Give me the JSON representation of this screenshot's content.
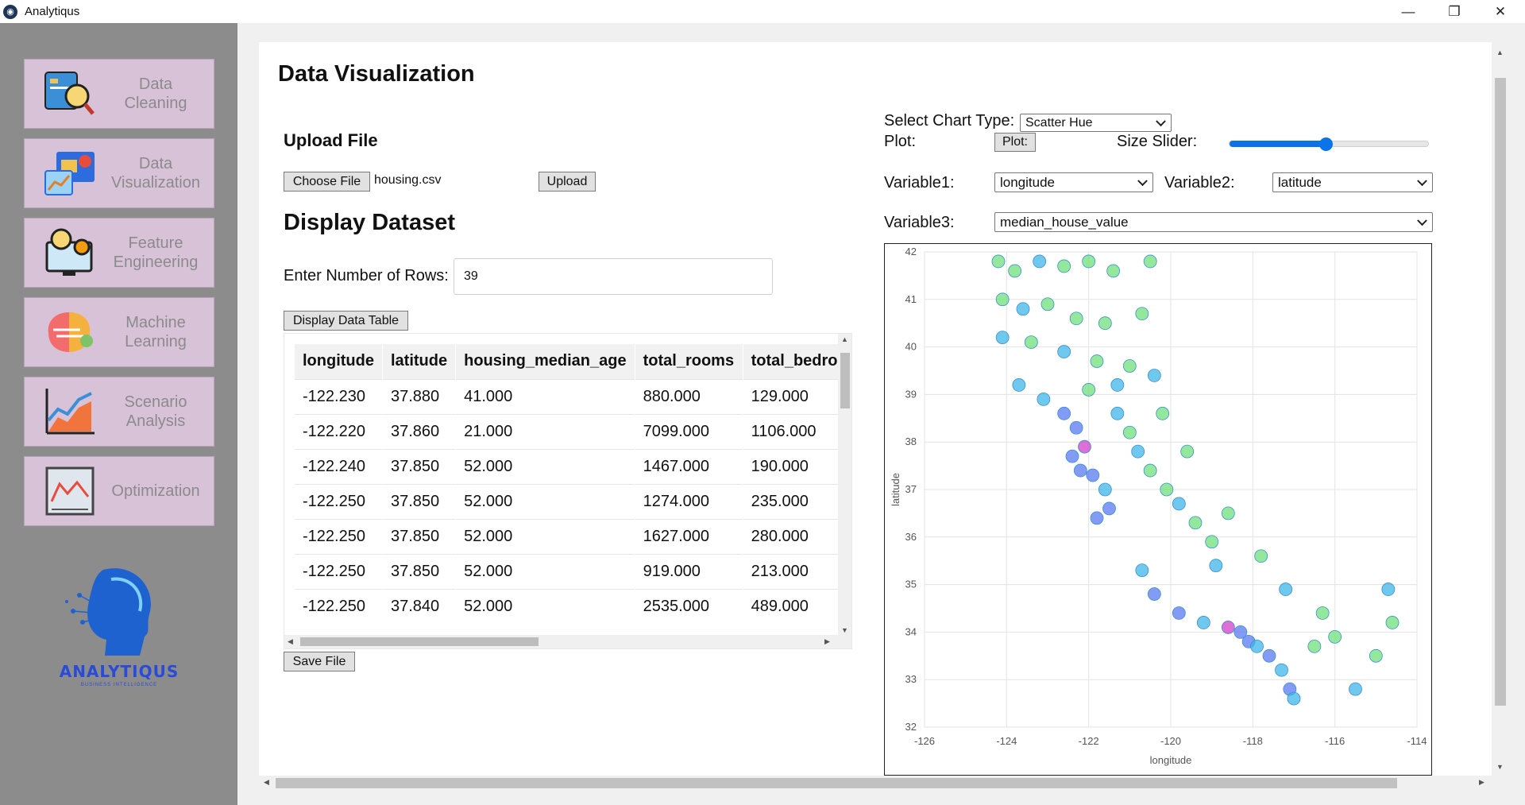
{
  "window": {
    "title": "Analytiqus",
    "controls": [
      "—",
      "❐",
      "✕"
    ]
  },
  "sidebar": {
    "items": [
      {
        "label": "Data\nCleaning",
        "icon": "data-cleaning-icon"
      },
      {
        "label": "Data\nVisualization",
        "icon": "data-visualization-icon"
      },
      {
        "label": "Feature\nEngineering",
        "icon": "feature-engineering-icon"
      },
      {
        "label": "Machine\nLearning",
        "icon": "machine-learning-icon"
      },
      {
        "label": "Scenario\nAnalysis",
        "icon": "scenario-analysis-icon"
      },
      {
        "label": "Optimization",
        "icon": "optimization-icon"
      }
    ],
    "brand": {
      "name": "ANALYTIQUS",
      "tagline": "BUSINESS INTELLIGENCE"
    }
  },
  "main": {
    "title": "Data Visualization",
    "upload": {
      "heading": "Upload File",
      "choose_label": "Choose File",
      "file_name": "housing.csv",
      "upload_label": "Upload"
    },
    "display": {
      "heading": "Display Dataset",
      "rows_label": "Enter Number of Rows:",
      "rows_value": "39",
      "display_button": "Display Data Table",
      "save_button": "Save File"
    },
    "table": {
      "columns": [
        "longitude",
        "latitude",
        "housing_median_age",
        "total_rooms",
        "total_bedro"
      ],
      "rows": [
        [
          "-122.230",
          "37.880",
          "41.000",
          "880.000",
          "129.000"
        ],
        [
          "-122.220",
          "37.860",
          "21.000",
          "7099.000",
          "1106.000"
        ],
        [
          "-122.240",
          "37.850",
          "52.000",
          "1467.000",
          "190.000"
        ],
        [
          "-122.250",
          "37.850",
          "52.000",
          "1274.000",
          "235.000"
        ],
        [
          "-122.250",
          "37.850",
          "52.000",
          "1627.000",
          "280.000"
        ],
        [
          "-122.250",
          "37.850",
          "52.000",
          "919.000",
          "213.000"
        ],
        [
          "-122.250",
          "37.840",
          "52.000",
          "2535.000",
          "489.000"
        ]
      ]
    },
    "controls": {
      "chart_type_label": "Select Chart Type:",
      "chart_type_value": "Scatter Hue",
      "plot_label": "Plot:",
      "plot_button": "Plot:",
      "size_slider_label": "Size Slider:",
      "size_slider_value": 0.48,
      "variable1_label": "Variable1:",
      "variable1_value": "longitude",
      "variable2_label": "Variable2:",
      "variable2_value": "latitude",
      "variable3_label": "Variable3:",
      "variable3_value": "median_house_value"
    }
  },
  "chart_data": {
    "type": "scatter",
    "title": "",
    "xlabel": "longitude",
    "ylabel": "latitude",
    "xlim": [
      -126,
      -114
    ],
    "ylim": [
      32,
      42
    ],
    "xticks": [
      -126,
      -124,
      -122,
      -120,
      -118,
      -116,
      -114
    ],
    "yticks": [
      32,
      33,
      34,
      35,
      36,
      37,
      38,
      39,
      40,
      41,
      42
    ],
    "grid": true,
    "hue": "median_house_value",
    "colors": {
      "low": "#6fe07a",
      "mid": "#3fb6e8",
      "high": "#5a7af0",
      "top": "#d23fc8"
    },
    "series": [
      {
        "values": [
          [
            -124.2,
            41.8,
            "low"
          ],
          [
            -123.8,
            41.6,
            "low"
          ],
          [
            -123.2,
            41.8,
            "mid"
          ],
          [
            -122.6,
            41.7,
            "low"
          ],
          [
            -122.0,
            41.8,
            "low"
          ],
          [
            -121.4,
            41.6,
            "low"
          ],
          [
            -120.5,
            41.8,
            "low"
          ],
          [
            -124.1,
            41.0,
            "low"
          ],
          [
            -123.6,
            40.8,
            "mid"
          ],
          [
            -123.0,
            40.9,
            "low"
          ],
          [
            -122.3,
            40.6,
            "low"
          ],
          [
            -121.6,
            40.5,
            "low"
          ],
          [
            -120.7,
            40.7,
            "low"
          ],
          [
            -124.1,
            40.2,
            "mid"
          ],
          [
            -123.4,
            40.1,
            "low"
          ],
          [
            -122.6,
            39.9,
            "mid"
          ],
          [
            -121.8,
            39.7,
            "low"
          ],
          [
            -121.0,
            39.6,
            "low"
          ],
          [
            -120.4,
            39.4,
            "mid"
          ],
          [
            -123.7,
            39.2,
            "mid"
          ],
          [
            -123.1,
            38.9,
            "mid"
          ],
          [
            -122.6,
            38.6,
            "high"
          ],
          [
            -122.3,
            38.3,
            "high"
          ],
          [
            -122.1,
            37.9,
            "top"
          ],
          [
            -122.4,
            37.7,
            "high"
          ],
          [
            -122.2,
            37.4,
            "high"
          ],
          [
            -121.9,
            37.3,
            "high"
          ],
          [
            -121.6,
            37.0,
            "mid"
          ],
          [
            -121.3,
            38.6,
            "mid"
          ],
          [
            -121.0,
            38.2,
            "low"
          ],
          [
            -120.8,
            37.8,
            "mid"
          ],
          [
            -120.5,
            37.4,
            "low"
          ],
          [
            -120.1,
            37.0,
            "low"
          ],
          [
            -119.8,
            36.7,
            "mid"
          ],
          [
            -119.4,
            36.3,
            "low"
          ],
          [
            -119.0,
            35.9,
            "low"
          ],
          [
            -118.9,
            35.4,
            "mid"
          ],
          [
            -120.7,
            35.3,
            "mid"
          ],
          [
            -120.4,
            34.8,
            "high"
          ],
          [
            -119.8,
            34.4,
            "high"
          ],
          [
            -119.2,
            34.2,
            "mid"
          ],
          [
            -118.6,
            34.1,
            "top"
          ],
          [
            -118.3,
            34.0,
            "high"
          ],
          [
            -118.1,
            33.8,
            "high"
          ],
          [
            -117.9,
            33.7,
            "mid"
          ],
          [
            -117.6,
            33.5,
            "high"
          ],
          [
            -117.3,
            33.2,
            "mid"
          ],
          [
            -117.1,
            32.8,
            "high"
          ],
          [
            -117.0,
            32.6,
            "mid"
          ],
          [
            -116.5,
            33.7,
            "low"
          ],
          [
            -116.0,
            33.9,
            "low"
          ],
          [
            -115.5,
            32.8,
            "mid"
          ],
          [
            -115.0,
            33.5,
            "low"
          ],
          [
            -114.6,
            34.2,
            "low"
          ],
          [
            -114.7,
            34.9,
            "mid"
          ],
          [
            -116.3,
            34.4,
            "low"
          ],
          [
            -117.2,
            34.9,
            "mid"
          ],
          [
            -117.8,
            35.6,
            "low"
          ],
          [
            -118.6,
            36.5,
            "low"
          ],
          [
            -119.6,
            37.8,
            "low"
          ],
          [
            -120.2,
            38.6,
            "low"
          ],
          [
            -121.3,
            39.2,
            "mid"
          ],
          [
            -122.0,
            39.1,
            "low"
          ],
          [
            -121.5,
            36.6,
            "high"
          ],
          [
            -121.8,
            36.4,
            "high"
          ]
        ]
      }
    ]
  }
}
